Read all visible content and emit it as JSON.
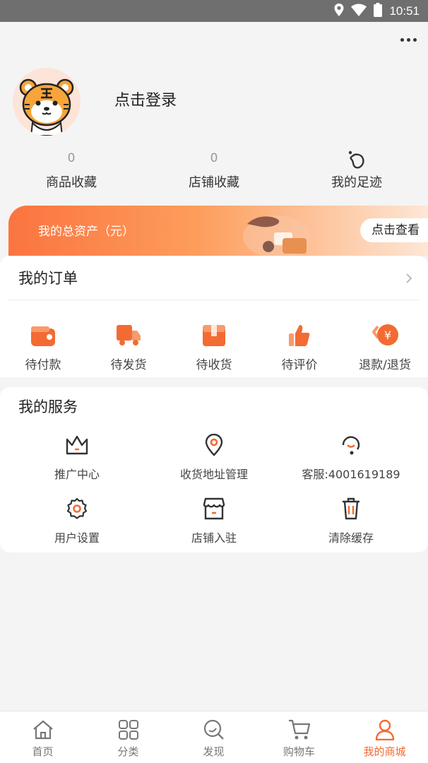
{
  "status_bar": {
    "time": "10:51",
    "icons": [
      "location-icon",
      "wifi-icon",
      "battery-icon"
    ]
  },
  "header": {
    "more_icon": "more-icon"
  },
  "profile": {
    "login_text": "点击登录",
    "avatar_icon": "tiger-avatar"
  },
  "stats": [
    {
      "value": "0",
      "label": "商品收藏"
    },
    {
      "value": "0",
      "label": "店铺收藏"
    },
    {
      "label": "我的足迹",
      "icon": "footprint-icon"
    }
  ],
  "assets": {
    "label": "我的总资产（元）",
    "button": "点击查看"
  },
  "orders": {
    "title": "我的订单",
    "items": [
      {
        "label": "待付款",
        "icon": "wallet-icon"
      },
      {
        "label": "待发货",
        "icon": "truck-icon"
      },
      {
        "label": "待收货",
        "icon": "box-icon"
      },
      {
        "label": "待评价",
        "icon": "thumbs-up-icon"
      },
      {
        "label": "退款/退货",
        "icon": "refund-icon"
      }
    ]
  },
  "services": {
    "title": "我的服务",
    "items": [
      {
        "label": "推广中心",
        "icon": "crown-icon"
      },
      {
        "label": "收货地址管理",
        "icon": "location-pin-icon"
      },
      {
        "label": "客服:4001619189",
        "icon": "headset-icon"
      },
      {
        "label": "用户设置",
        "icon": "settings-icon"
      },
      {
        "label": "店铺入驻",
        "icon": "store-icon"
      },
      {
        "label": "清除缓存",
        "icon": "trash-icon"
      }
    ]
  },
  "tabbar": [
    {
      "label": "首页",
      "icon": "home-icon"
    },
    {
      "label": "分类",
      "icon": "grid-icon"
    },
    {
      "label": "发现",
      "icon": "discover-icon"
    },
    {
      "label": "购物车",
      "icon": "cart-icon"
    },
    {
      "label": "我的商城",
      "icon": "user-icon",
      "active": true
    }
  ],
  "colors": {
    "accent": "#f5692f",
    "status_bar": "#6f6f6f",
    "background": "#f4f4f4"
  }
}
